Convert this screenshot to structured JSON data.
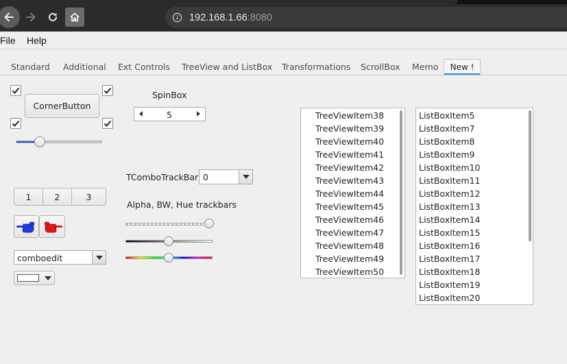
{
  "browser": {
    "host": "192.168.1.66",
    "port": ":8080"
  },
  "menu": [
    "File",
    "Help"
  ],
  "tabs": [
    "Standard",
    "Additional",
    "Ext Controls",
    "TreeView and ListBox",
    "Transformations",
    "ScrollBox",
    "Memo",
    "New !"
  ],
  "active_tab": "New !",
  "left_panel": {
    "corner_button": "CornerButton",
    "segment_buttons": [
      "1",
      "2",
      "3"
    ],
    "combo_edit": "comboedit",
    "hand_colors": [
      "#1e3cdc",
      "#e01818"
    ]
  },
  "middle_panel": {
    "spinbox_label": "SpinBox",
    "spinbox_value": "5",
    "combotrackbar_label": "TComboTrackBar:",
    "combotrackbar_value": "0",
    "trackbars_label": "Alpha, BW, Hue trackbars"
  },
  "treeview": {
    "items": [
      "TreeViewItem38",
      "TreeViewItem39",
      "TreeViewItem40",
      "TreeViewItem41",
      "TreeViewItem42",
      "TreeViewItem43",
      "TreeViewItem44",
      "TreeViewItem45",
      "TreeViewItem46",
      "TreeViewItem47",
      "TreeViewItem48",
      "TreeViewItem49",
      "TreeViewItem50"
    ]
  },
  "listbox": {
    "items": [
      "ListBoxItem5",
      "ListBoxItem7",
      "ListBoxItem8",
      "ListBoxItem9",
      "ListBoxItem10",
      "ListBoxItem11",
      "ListBoxItem12",
      "ListBoxItem13",
      "ListBoxItem14",
      "ListBoxItem15",
      "ListBoxItem16",
      "ListBoxItem17",
      "ListBoxItem18",
      "ListBoxItem19",
      "ListBoxItem20"
    ]
  }
}
